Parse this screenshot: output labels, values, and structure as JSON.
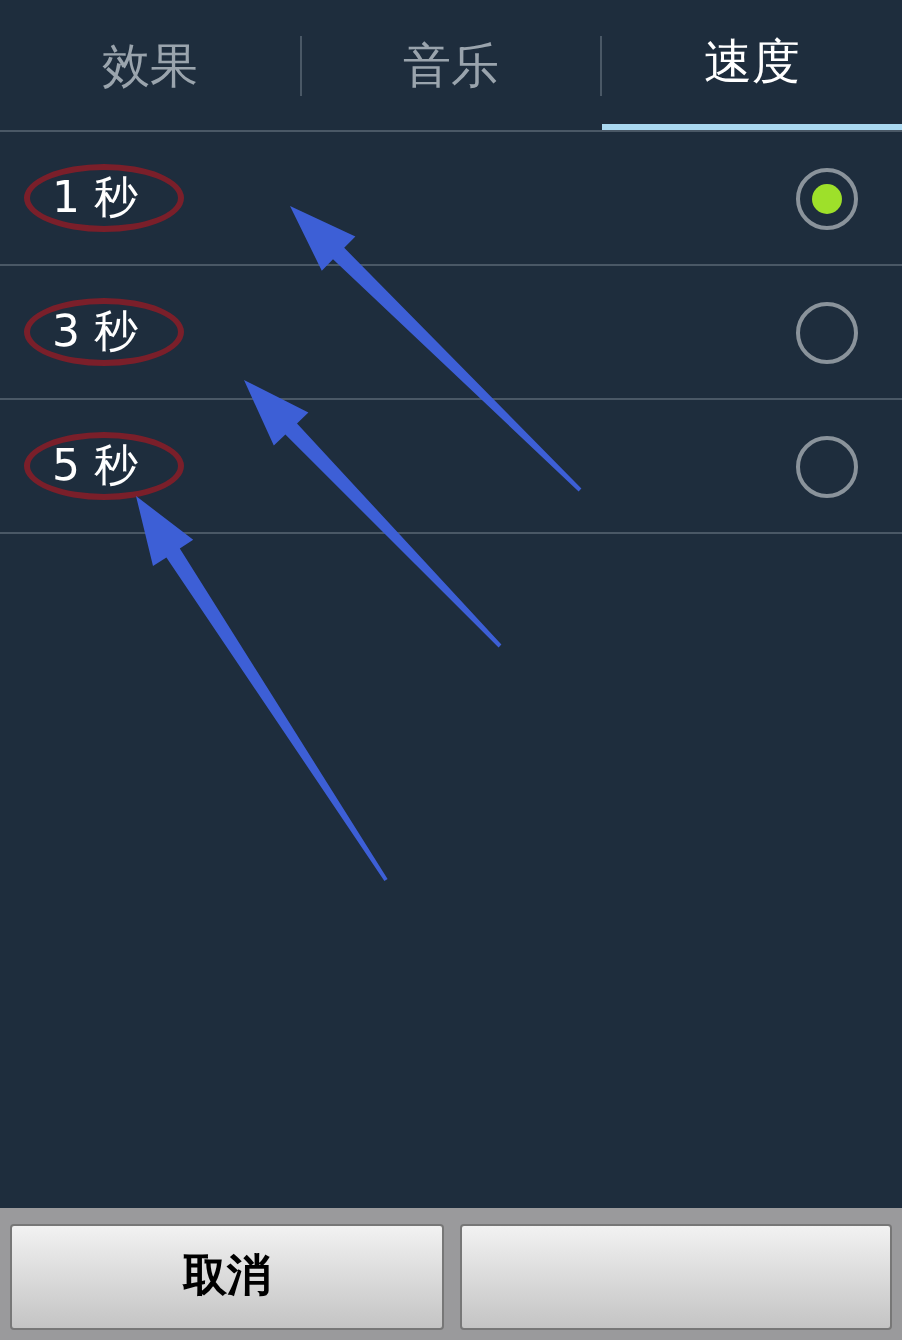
{
  "tabs": [
    {
      "label": "效果",
      "selected": false
    },
    {
      "label": "音乐",
      "selected": false
    },
    {
      "label": "速度",
      "selected": true
    }
  ],
  "options": [
    {
      "label": "1 秒",
      "selected": true,
      "marked": true
    },
    {
      "label": "3 秒",
      "selected": false,
      "marked": true
    },
    {
      "label": "5 秒",
      "selected": false,
      "marked": true
    }
  ],
  "buttons": [
    {
      "kind": "text",
      "label": "取消"
    },
    {
      "kind": "covered"
    }
  ]
}
